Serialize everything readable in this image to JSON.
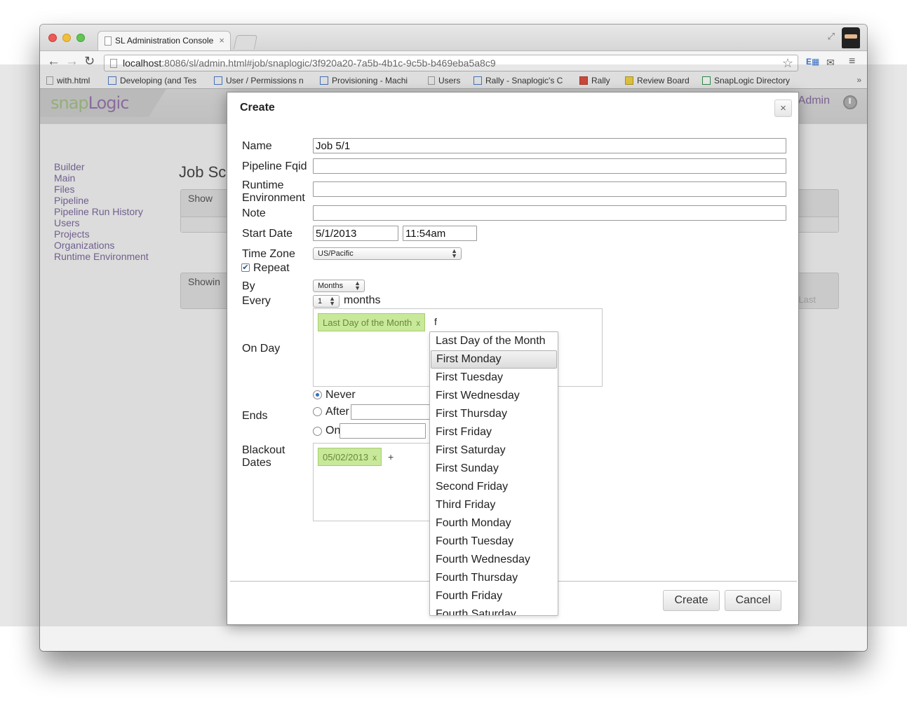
{
  "browser": {
    "tab_title": "SL Administration Console",
    "tab_close": "×",
    "url_host": "localhost",
    "url_path": ":8086/sl/admin.html#job/snaplogic/3f920a20-7a5b-4b1c-9c5b-b469eba5a8c9",
    "bookmarks": [
      {
        "label": "with.html",
        "icon": "doc-icon"
      },
      {
        "label": "Developing (and Tes",
        "icon": "page-icon"
      },
      {
        "label": "User / Permissions n",
        "icon": "page-icon"
      },
      {
        "label": "Provisioning - Machi",
        "icon": "page-icon"
      },
      {
        "label": "Users",
        "icon": "doc-icon"
      },
      {
        "label": "Rally - Snaplogic's C",
        "icon": "page-icon"
      },
      {
        "label": "Rally",
        "icon": "rally-icon"
      },
      {
        "label": "Review Board",
        "icon": "reviewboard-icon"
      },
      {
        "label": "SnapLogic Directory",
        "icon": "sheet-icon"
      }
    ],
    "bookmarks_more": "»"
  },
  "app": {
    "logo_snap": "snap",
    "logo_logic": "Logic",
    "admin_link": "Admin",
    "nav": [
      "Builder",
      "Main",
      "Files",
      "Pipeline",
      "Pipeline Run History",
      "Users",
      "Projects",
      "Organizations",
      "Runtime Environment"
    ],
    "page_title": "Job Sc",
    "show_label": "Show",
    "showing_label": "Showin",
    "last_label": "Last"
  },
  "dialog": {
    "title": "Create",
    "close": "×",
    "labels": {
      "name": "Name",
      "pipeline_fqid": "Pipeline Fqid",
      "runtime_env_1": "Runtime",
      "runtime_env_2": "Environment",
      "note": "Note",
      "start_date": "Start Date",
      "time_zone": "Time Zone",
      "repeat": "Repeat",
      "by": "By",
      "every": "Every",
      "every_unit": "months",
      "on_day": "On Day",
      "ends": "Ends",
      "never": "Never",
      "after": "After",
      "on": "On",
      "blackout_1": "Blackout",
      "blackout_2": "Dates"
    },
    "values": {
      "name": "Job 5/1",
      "pipeline_fqid": "",
      "runtime_environment": "",
      "note": "",
      "start_date": "5/1/2013",
      "start_time": "11:54am",
      "time_zone": "US/Pacific",
      "repeat_checked": true,
      "by": "Months",
      "every": "1",
      "on_day_tags": [
        "Last Day of the Month"
      ],
      "on_day_query": "f",
      "ends_selected": "Never",
      "blackout_tags": [
        "05/02/2013"
      ],
      "blackout_add": "+"
    },
    "tag_remove": "x",
    "dropdown_options": [
      "Last Day of the Month",
      "First Monday",
      "First Tuesday",
      "First Wednesday",
      "First Thursday",
      "First Friday",
      "First Saturday",
      "First Sunday",
      "Second Friday",
      "Third Friday",
      "Fourth Monday",
      "Fourth Tuesday",
      "Fourth Wednesday",
      "Fourth Thursday",
      "Fourth Friday",
      "Fourth Saturday"
    ],
    "dropdown_highlighted": "First Monday",
    "buttons": {
      "create": "Create",
      "cancel": "Cancel"
    }
  }
}
